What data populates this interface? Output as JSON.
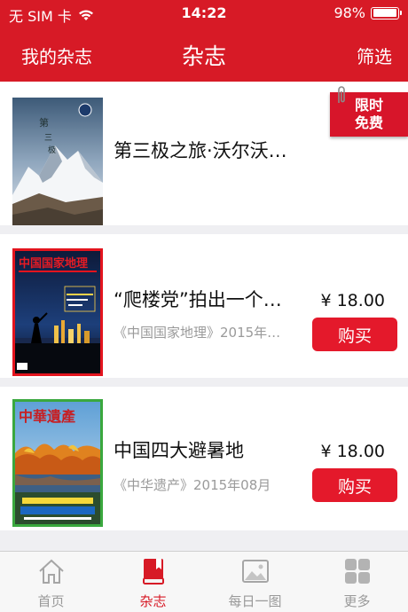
{
  "status_bar": {
    "carrier": "无 SIM 卡",
    "time": "14:22",
    "battery": "98%"
  },
  "nav": {
    "left": "我的杂志",
    "title": "杂志",
    "right": "筛选"
  },
  "items": [
    {
      "title": "第三极之旅·沃尔沃…",
      "subtitle": "",
      "price": "",
      "buy_label": "",
      "badge": [
        "限时",
        "免费"
      ]
    },
    {
      "title": "“爬楼党”拍出一个…",
      "subtitle": "《中国国家地理》2015年…",
      "price": "¥ 18.00",
      "buy_label": "购买",
      "cover_title": "中国国家地理"
    },
    {
      "title": "中国四大避暑地",
      "subtitle": "《中华遗产》2015年08月",
      "price": "¥ 18.00",
      "buy_label": "购买",
      "cover_title": "中華遺產"
    }
  ],
  "tabs": [
    {
      "label": "首页",
      "icon": "home-icon"
    },
    {
      "label": "杂志",
      "icon": "magazine-icon"
    },
    {
      "label": "每日一图",
      "icon": "picture-icon"
    },
    {
      "label": "更多",
      "icon": "grid-icon"
    }
  ],
  "colors": {
    "brand_red": "#d71a26",
    "button_red": "#e4192b",
    "background": "#efeff2",
    "tab_inactive": "#999999"
  }
}
